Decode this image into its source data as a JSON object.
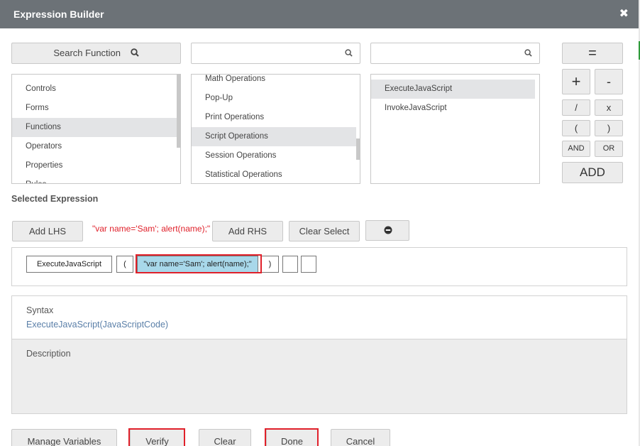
{
  "dialog": {
    "title": "Expression Builder",
    "close_symbol": "✖"
  },
  "search_function": {
    "label": "Search Function"
  },
  "search_1": {
    "value": "",
    "placeholder": ""
  },
  "search_2": {
    "value": "",
    "placeholder": ""
  },
  "categories": [
    "Controls",
    "Forms",
    "Functions",
    "Operators",
    "Properties",
    "Rules"
  ],
  "category_groups": [
    "Math Operations",
    "Pop-Up",
    "Print Operations",
    "Script Operations",
    "Session Operations",
    "Statistical Operations"
  ],
  "functions": [
    "ExecuteJavaScript",
    "InvokeJavaScript"
  ],
  "operators": {
    "equals": "=",
    "plus": "+",
    "minus": "-",
    "divide": "/",
    "multiply": "x",
    "open_paren": "(",
    "close_paren": ")",
    "and": "AND",
    "or": "OR",
    "add": "ADD"
  },
  "selected_expression": {
    "label": "Selected Expression",
    "add_lhs": "Add LHS",
    "preview": "\"var name='Sam'; alert(name);\"",
    "add_rhs": "Add RHS",
    "clear_select": "Clear Select"
  },
  "expression_tokens": {
    "function": "ExecuteJavaScript",
    "open": "(",
    "arg": "\"var name='Sam'; alert(name);\"",
    "close": ")",
    "empty1": "",
    "empty2": ""
  },
  "syntax": {
    "label": "Syntax",
    "value": "ExecuteJavaScript(JavaScriptCode)"
  },
  "description": {
    "label": "Description",
    "value": ""
  },
  "footer": {
    "manage_variables": "Manage Variables",
    "verify": "Verify",
    "clear": "Clear",
    "done": "Done",
    "cancel": "Cancel"
  },
  "colors": {
    "titlebar": "#6c7277",
    "highlight_red": "#e0202a",
    "link_blue": "#5a7fa8",
    "preview_red": "#e0202a",
    "token_highlight": "#a8d8ea"
  }
}
